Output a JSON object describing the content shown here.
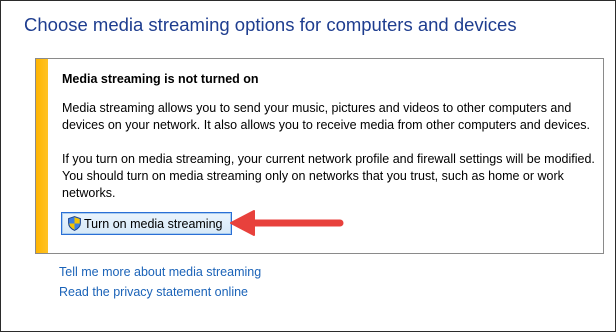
{
  "page": {
    "title": "Choose media streaming options for computers and devices"
  },
  "panel": {
    "heading": "Media streaming is not turned on",
    "paragraph1": "Media streaming allows you to send your music, pictures and videos to other computers and devices on your network.  It also allows you to receive media from other computers and devices.",
    "paragraph2": "If you turn on media streaming, your current network profile and firewall settings will be modified. You should turn on media streaming only on networks that you trust, such as home or work networks.",
    "button_label": "Turn on media streaming",
    "button_icon": "uac-shield-icon",
    "stripe_color": "#ffb400"
  },
  "annotation": {
    "arrow_color": "#e8413c"
  },
  "links": [
    {
      "label": "Tell me more about media streaming"
    },
    {
      "label": "Read the privacy statement online"
    }
  ],
  "colors": {
    "title": "#1e3d8f",
    "link": "#1b63b8",
    "button_border": "#2a6fd6"
  }
}
